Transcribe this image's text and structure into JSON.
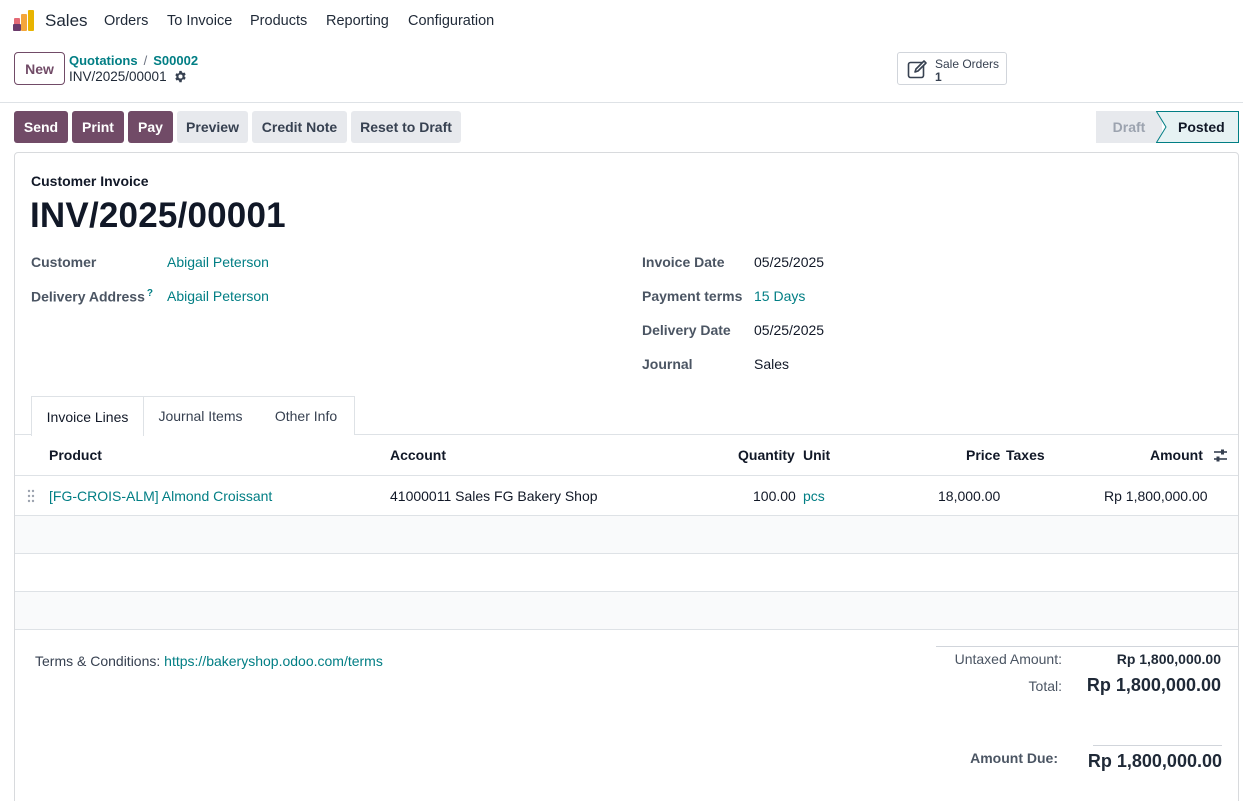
{
  "navbar": {
    "app_name": "Sales",
    "menu": [
      "Orders",
      "To Invoice",
      "Products",
      "Reporting",
      "Configuration"
    ]
  },
  "control_panel": {
    "new_label": "New",
    "breadcrumb": [
      "Quotations",
      "S00002"
    ],
    "current_record": "INV/2025/00001",
    "smart_button": {
      "label": "Sale Orders",
      "count": "1"
    }
  },
  "actions": {
    "send": "Send",
    "print": "Print",
    "pay": "Pay",
    "preview": "Preview",
    "credit_note": "Credit Note",
    "reset_to_draft": "Reset to Draft"
  },
  "statusbar": {
    "stages": [
      "Draft",
      "Posted"
    ],
    "current": "Posted"
  },
  "invoice": {
    "type": "Customer Invoice",
    "name": "INV/2025/00001",
    "customer_label": "Customer",
    "customer": "Abigail Peterson",
    "delivery_address_label": "Delivery Address",
    "delivery_address_help": "?",
    "delivery_address": "Abigail Peterson",
    "invoice_date_label": "Invoice Date",
    "invoice_date": "05/25/2025",
    "payment_terms_label": "Payment terms",
    "payment_terms": "15 Days",
    "delivery_date_label": "Delivery Date",
    "delivery_date": "05/25/2025",
    "journal_label": "Journal",
    "journal": "Sales"
  },
  "tabs": [
    "Invoice Lines",
    "Journal Items",
    "Other Info"
  ],
  "lines": {
    "headers": {
      "product": "Product",
      "account": "Account",
      "quantity": "Quantity",
      "unit": "Unit",
      "price": "Price",
      "taxes": "Taxes",
      "amount": "Amount"
    },
    "rows": [
      {
        "product": "[FG-CROIS-ALM] Almond Croissant",
        "account": "41000011 Sales FG Bakery Shop",
        "quantity": "100.00",
        "unit": "pcs",
        "price": "18,000.00",
        "taxes": "",
        "amount": "Rp 1,800,000.00"
      }
    ]
  },
  "footer": {
    "terms_label": "Terms & Conditions:",
    "terms_link": "https://bakeryshop.odoo.com/terms",
    "untaxed_label": "Untaxed Amount:",
    "untaxed": "Rp 1,800,000.00",
    "total_label": "Total:",
    "total": "Rp 1,800,000.00",
    "amount_due_label": "Amount Due:",
    "amount_due": "Rp 1,800,000.00"
  },
  "colors": {
    "primary": "#714b67",
    "link": "#017e84",
    "secondary_btn": "#e7e9ed",
    "status_active_border": "#017e84"
  }
}
